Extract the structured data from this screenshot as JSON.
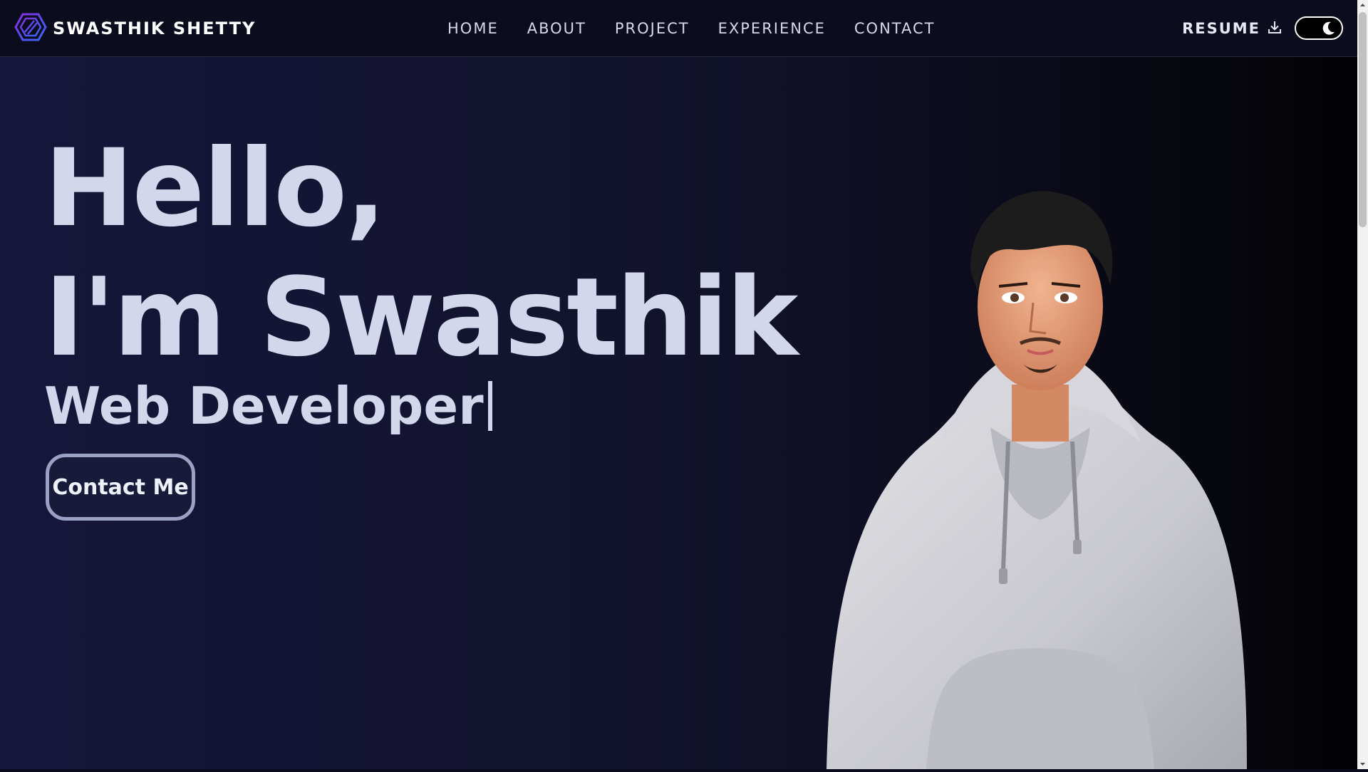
{
  "brand": {
    "name": "SWASTHIK SHETTY",
    "logo_icon": "hexagon-logo-icon"
  },
  "nav": {
    "items": [
      "HOME",
      "ABOUT",
      "PROJECT",
      "EXPERIENCE",
      "CONTACT"
    ]
  },
  "resume": {
    "label": "RESUME",
    "icon": "download-icon"
  },
  "theme_toggle": {
    "icon": "moon-icon",
    "mode": "dark"
  },
  "hero": {
    "greeting": "Hello,",
    "name_line": "I'm Swasthik",
    "role": "Web Developer",
    "cta_label": "Contact Me"
  },
  "colors": {
    "background_start": "#15163a",
    "background_end": "#020205",
    "text": "#d3d7ec",
    "logo_purple": "#7b2ff7",
    "logo_blue": "#3b6cf7"
  }
}
